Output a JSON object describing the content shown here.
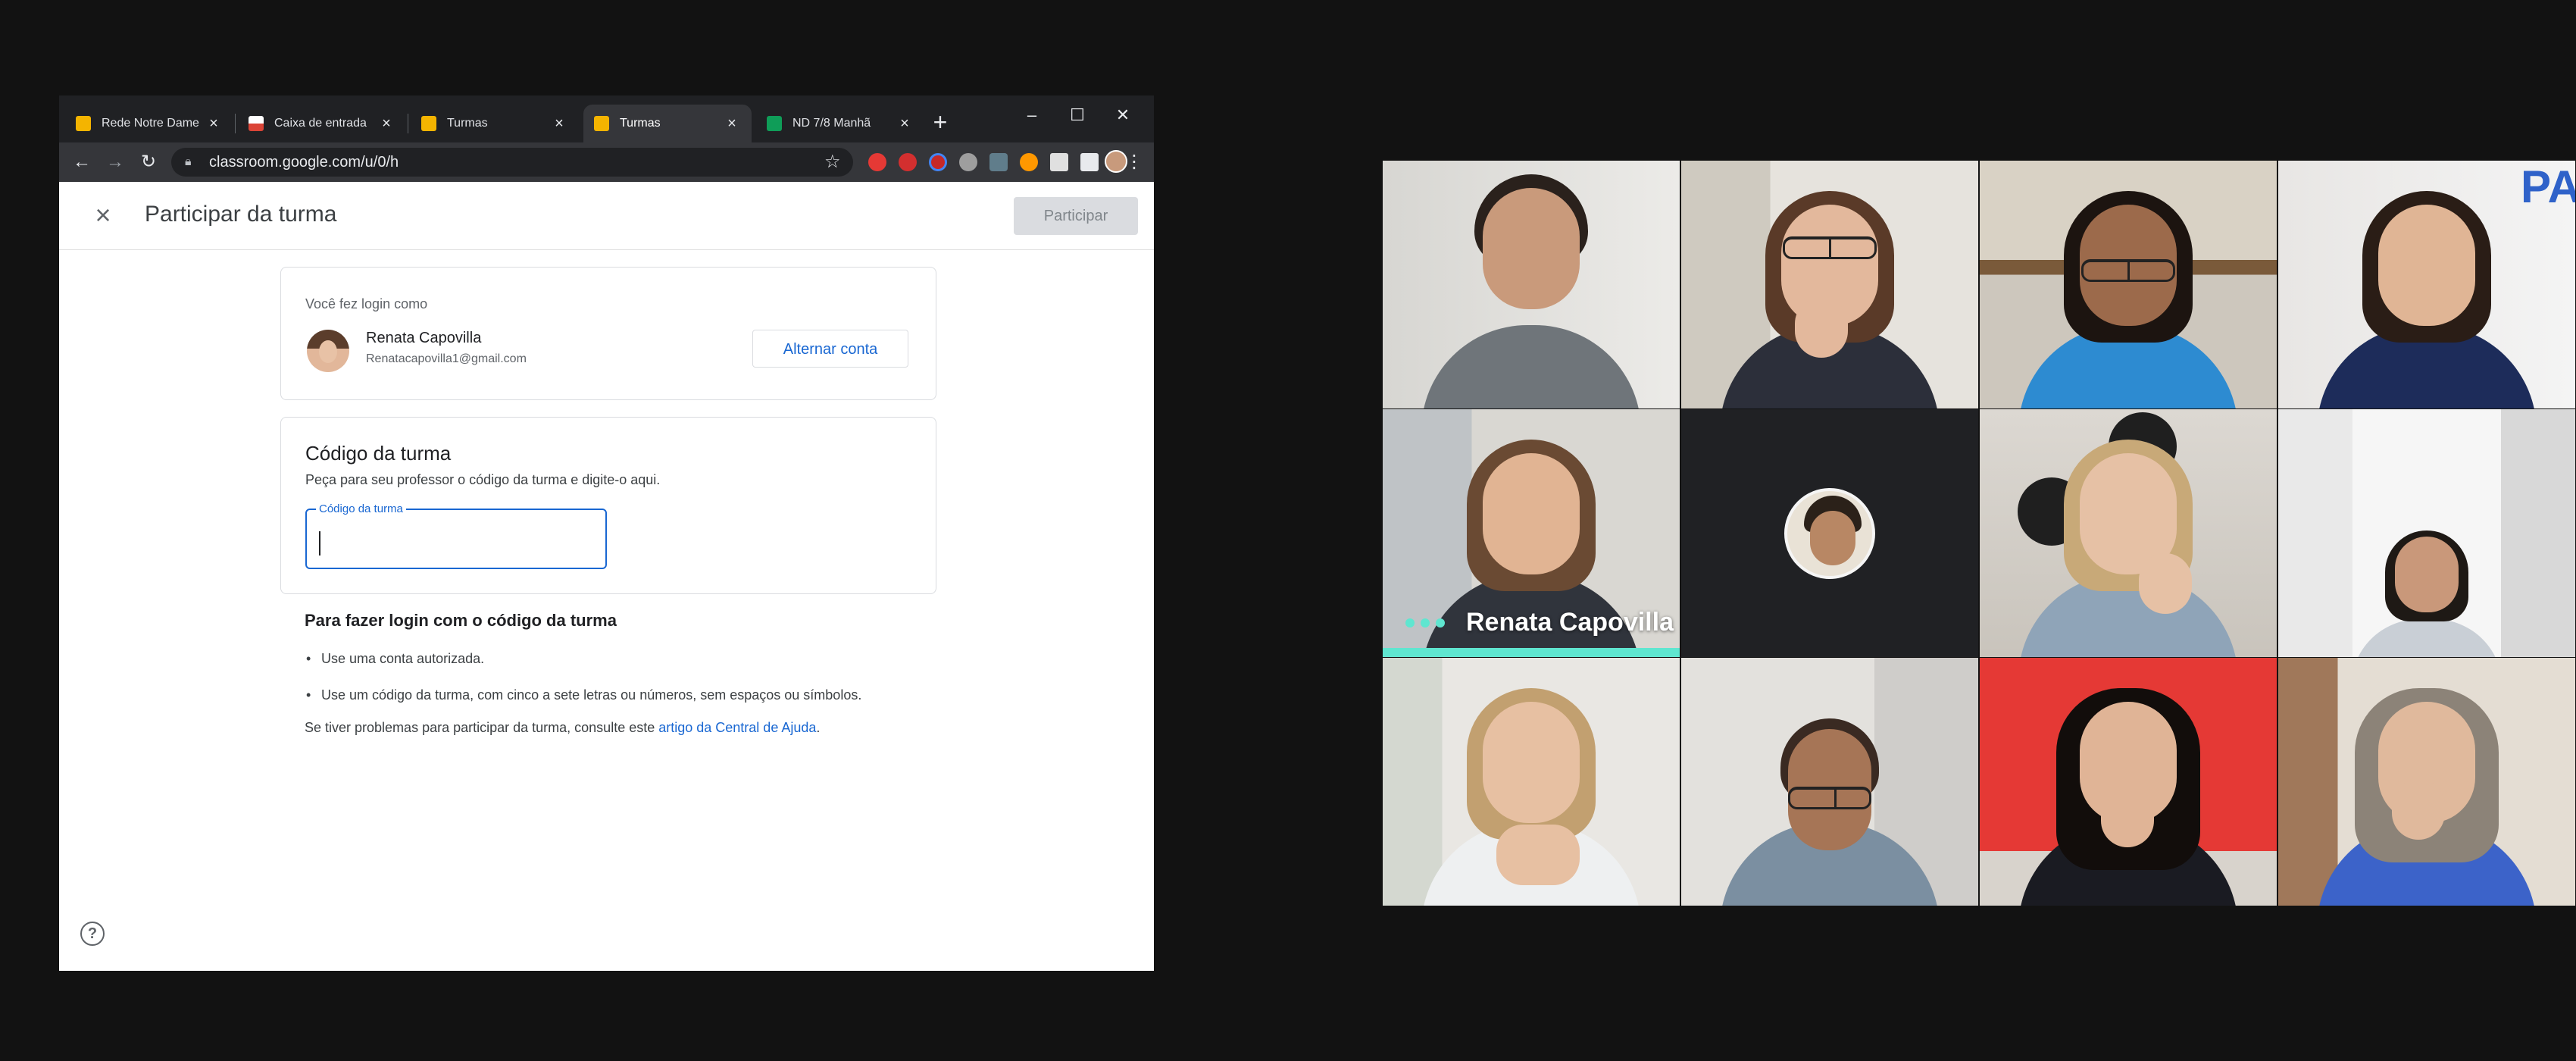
{
  "browser": {
    "tabs": [
      {
        "title": "Rede Notre Dame",
        "favicon_color": "#f4b400",
        "active": false
      },
      {
        "title": "Caixa de entrada",
        "favicon_color": "#db4437",
        "active": false
      },
      {
        "title": "Turmas",
        "favicon_color": "#f4b400",
        "active": false
      },
      {
        "title": "Turmas",
        "favicon_color": "#f4b400",
        "active": true
      },
      {
        "title": "ND 7/8 Manhã",
        "favicon_color": "#0f9d58",
        "active": false
      }
    ],
    "new_tab_glyph": "+",
    "url": "classroom.google.com/u/0/h",
    "window_controls": {
      "minimize": "–",
      "maximize": "☐",
      "close": "✕"
    }
  },
  "classroom": {
    "page_title": "Participar da turma",
    "join_button": "Participar",
    "account": {
      "label": "Você fez login como",
      "name": "Renata Capovilla",
      "email": "Renatacapovilla1@gmail.com",
      "switch_button": "Alternar conta"
    },
    "class_code": {
      "heading": "Código da turma",
      "description": "Peça para seu professor o código da turma e digite-o aqui.",
      "field_label": "Código da turma",
      "value": ""
    },
    "help": {
      "heading": "Para fazer login com o código da turma",
      "items": [
        "Use uma conta autorizada.",
        "Use um código da turma, com cinco a sete letras ou números, sem espaços ou símbolos."
      ],
      "footer_prefix": "Se tiver problemas para participar da turma, consulte este ",
      "footer_link": "artigo da Central de Ajuda",
      "footer_suffix": "."
    }
  },
  "meeting": {
    "speaker_name": "Renata Capovilla",
    "banner_text": "PA"
  }
}
